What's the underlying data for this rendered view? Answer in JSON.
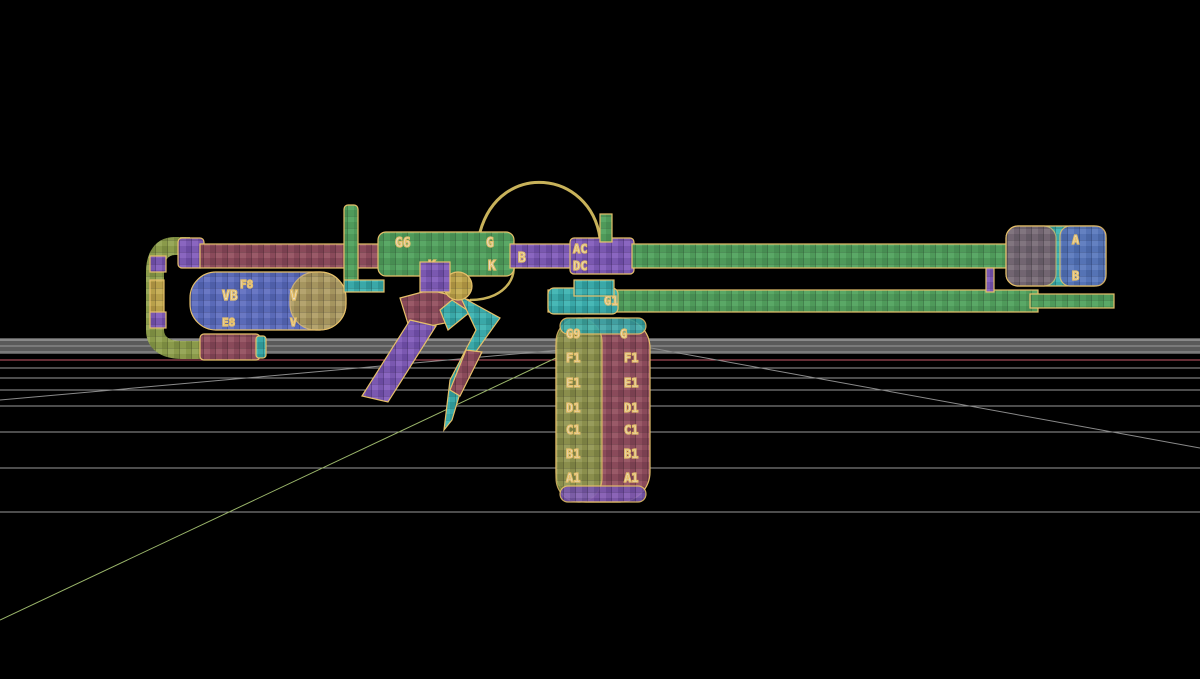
{
  "viewport": {
    "background": "#000000",
    "grid_color": "#9a9a9a",
    "horizon_color": "#b8b8b8",
    "axis_x_color": "#c85a6a",
    "axis_z_color": "#9ab56a",
    "outline_color": "#e6c06a"
  },
  "model": {
    "uv_labels": {
      "receiver_left": "G6",
      "receiver_right": "G",
      "receiver_mid_k1": "K",
      "receiver_mid_k2": "K",
      "coupler_ab": "B",
      "valve_top": "AC",
      "valve_bottom": "DC",
      "nozzle_ring": "G1",
      "tank_left_top": "F8",
      "tank_left_mid": "VB",
      "tank_left_right": "V",
      "tank_left_bottom": "E8",
      "tank_left_bottom_r": "V",
      "cyl_top_left": "G9",
      "cyl_top_right": "G",
      "cyl_f_l": "F1",
      "cyl_f_r": "F1",
      "cyl_e_l": "E1",
      "cyl_e_r": "E1",
      "cyl_d_l": "D1",
      "cyl_d_r": "D1",
      "cyl_c_l": "C1",
      "cyl_c_r": "C1",
      "cyl_b_l": "B1",
      "cyl_b_r": "B1",
      "cyl_a_l": "A1",
      "cyl_a_r": "A1",
      "muzzle_a": "A",
      "muzzle_b": "B"
    }
  }
}
